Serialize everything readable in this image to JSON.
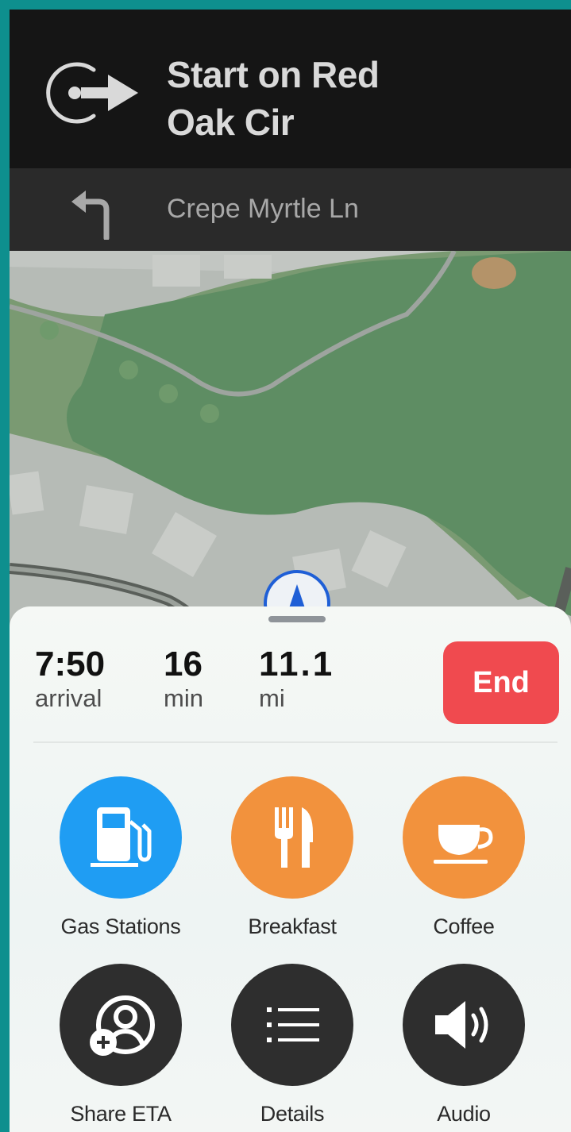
{
  "banner": {
    "instruction_line1": "Start on Red",
    "instruction_line2": "Oak Cir",
    "next_street": "Crepe Myrtle Ln"
  },
  "trip": {
    "arrival_value": "7:50",
    "arrival_label": "arrival",
    "duration_value": "16",
    "duration_label": "min",
    "distance_value": "11.1",
    "distance_label": "mi",
    "end_label": "End"
  },
  "actions": [
    {
      "label": "Gas Stations",
      "icon": "gas-pump-icon",
      "color": "#1f9df3"
    },
    {
      "label": "Breakfast",
      "icon": "fork-knife-icon",
      "color": "#f2923d"
    },
    {
      "label": "Coffee",
      "icon": "coffee-cup-icon",
      "color": "#f2923d"
    },
    {
      "label": "Share ETA",
      "icon": "share-eta-icon",
      "color": "#2e2e2e"
    },
    {
      "label": "Details",
      "icon": "list-icon",
      "color": "#2e2e2e"
    },
    {
      "label": "Audio",
      "icon": "speaker-icon",
      "color": "#2e2e2e"
    }
  ],
  "colors": {
    "park": "#5e8d63",
    "land": "#b3b8b3",
    "end_button": "#f04a4f",
    "location_marker": "#1f5fd6"
  }
}
